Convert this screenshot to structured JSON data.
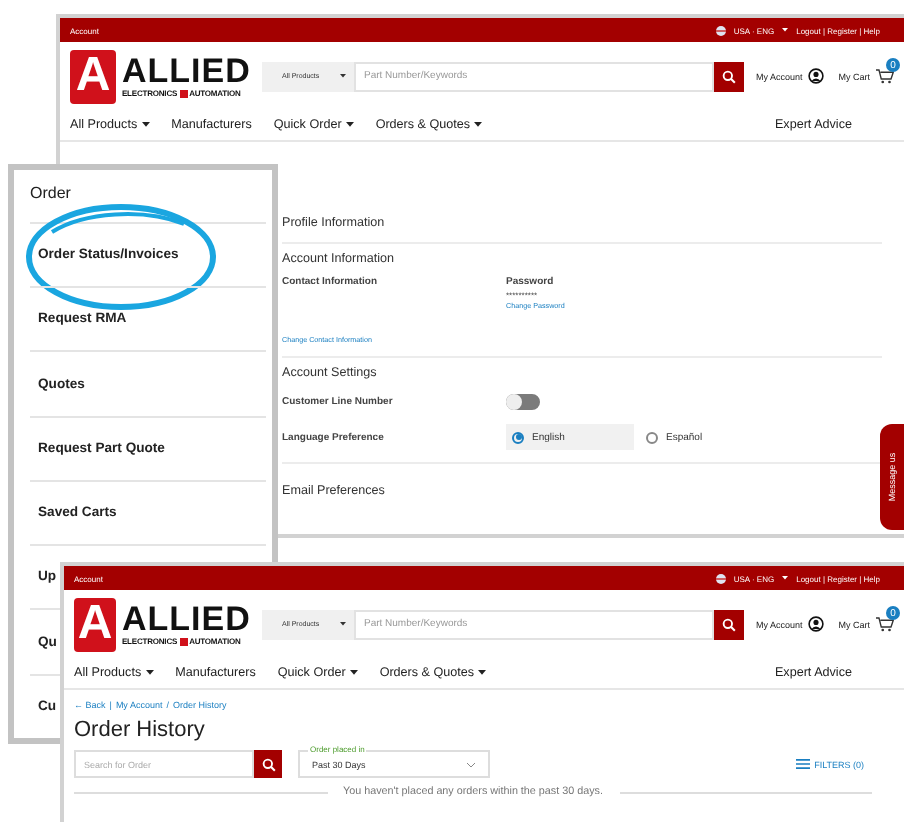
{
  "account_window": {
    "header": {
      "account_label": "Account",
      "locale": "USA · ENG",
      "top_links": "Logout | Register | Help",
      "logo_letter": "A",
      "logo_name": "ALLIED",
      "logo_tagline_left": "ELECTRONICS",
      "logo_tagline_right": "AUTOMATION",
      "category": "All Products",
      "search_placeholder": "Part Number/Keywords",
      "my_account": "My Account",
      "my_cart": "My Cart",
      "cart_count": "0",
      "nav": [
        {
          "label": "All Products",
          "dropdown": true
        },
        {
          "label": "Manufacturers",
          "dropdown": false
        },
        {
          "label": "Quick Order",
          "dropdown": true
        },
        {
          "label": "Orders & Quotes",
          "dropdown": true
        }
      ],
      "expert": "Expert Advice"
    },
    "profile_title": "Profile Information",
    "account_info_title": "Account Information",
    "contact_label": "Contact Information",
    "password_label": "Password",
    "password_value": "**********",
    "change_password": "Change Password",
    "change_contact": "Change Contact Information",
    "settings_title": "Account Settings",
    "line_number_label": "Customer Line Number",
    "line_number_on": false,
    "language_label": "Language Preference",
    "languages": [
      {
        "label": "English",
        "selected": true
      },
      {
        "label": "Español",
        "selected": false
      }
    ],
    "email_title": "Email Preferences",
    "message_tab": "Message us"
  },
  "sidebar_panel": {
    "title": "Order",
    "items": [
      {
        "label": "Order Status/Invoices",
        "circled": true
      },
      {
        "label": "Request RMA",
        "circled": false
      },
      {
        "label": "Quotes",
        "circled": false
      },
      {
        "label": "Request Part Quote",
        "circled": false
      },
      {
        "label": "Saved Carts",
        "circled": false
      },
      {
        "label": "Up",
        "circled": false
      },
      {
        "label": "Qu",
        "circled": false
      },
      {
        "label": "Cu",
        "circled": false
      }
    ]
  },
  "order_window": {
    "header": {
      "account_label": "Account",
      "locale": "USA · ENG",
      "top_links": "Logout | Register | Help",
      "logo_letter": "A",
      "logo_name": "ALLIED",
      "logo_tagline_left": "ELECTRONICS",
      "logo_tagline_right": "AUTOMATION",
      "category": "All Products",
      "search_placeholder": "Part Number/Keywords",
      "my_account": "My Account",
      "my_cart": "My Cart",
      "cart_count": "0",
      "nav": [
        {
          "label": "All Products",
          "dropdown": true
        },
        {
          "label": "Manufacturers",
          "dropdown": false
        },
        {
          "label": "Quick Order",
          "dropdown": true
        },
        {
          "label": "Orders & Quotes",
          "dropdown": true
        }
      ],
      "expert": "Expert Advice"
    },
    "breadcrumb": [
      {
        "label": "← Back"
      },
      {
        "separator": "|",
        "label": "My Account"
      },
      {
        "separator": "/",
        "label": "Order History"
      }
    ],
    "title": "Order History",
    "search_placeholder": "Search for Order",
    "period_label": "Order placed in",
    "period_value": "Past 30 Days",
    "filters": "FILTERS (0)",
    "empty_message": "You haven't placed any orders within the past 30 days."
  }
}
